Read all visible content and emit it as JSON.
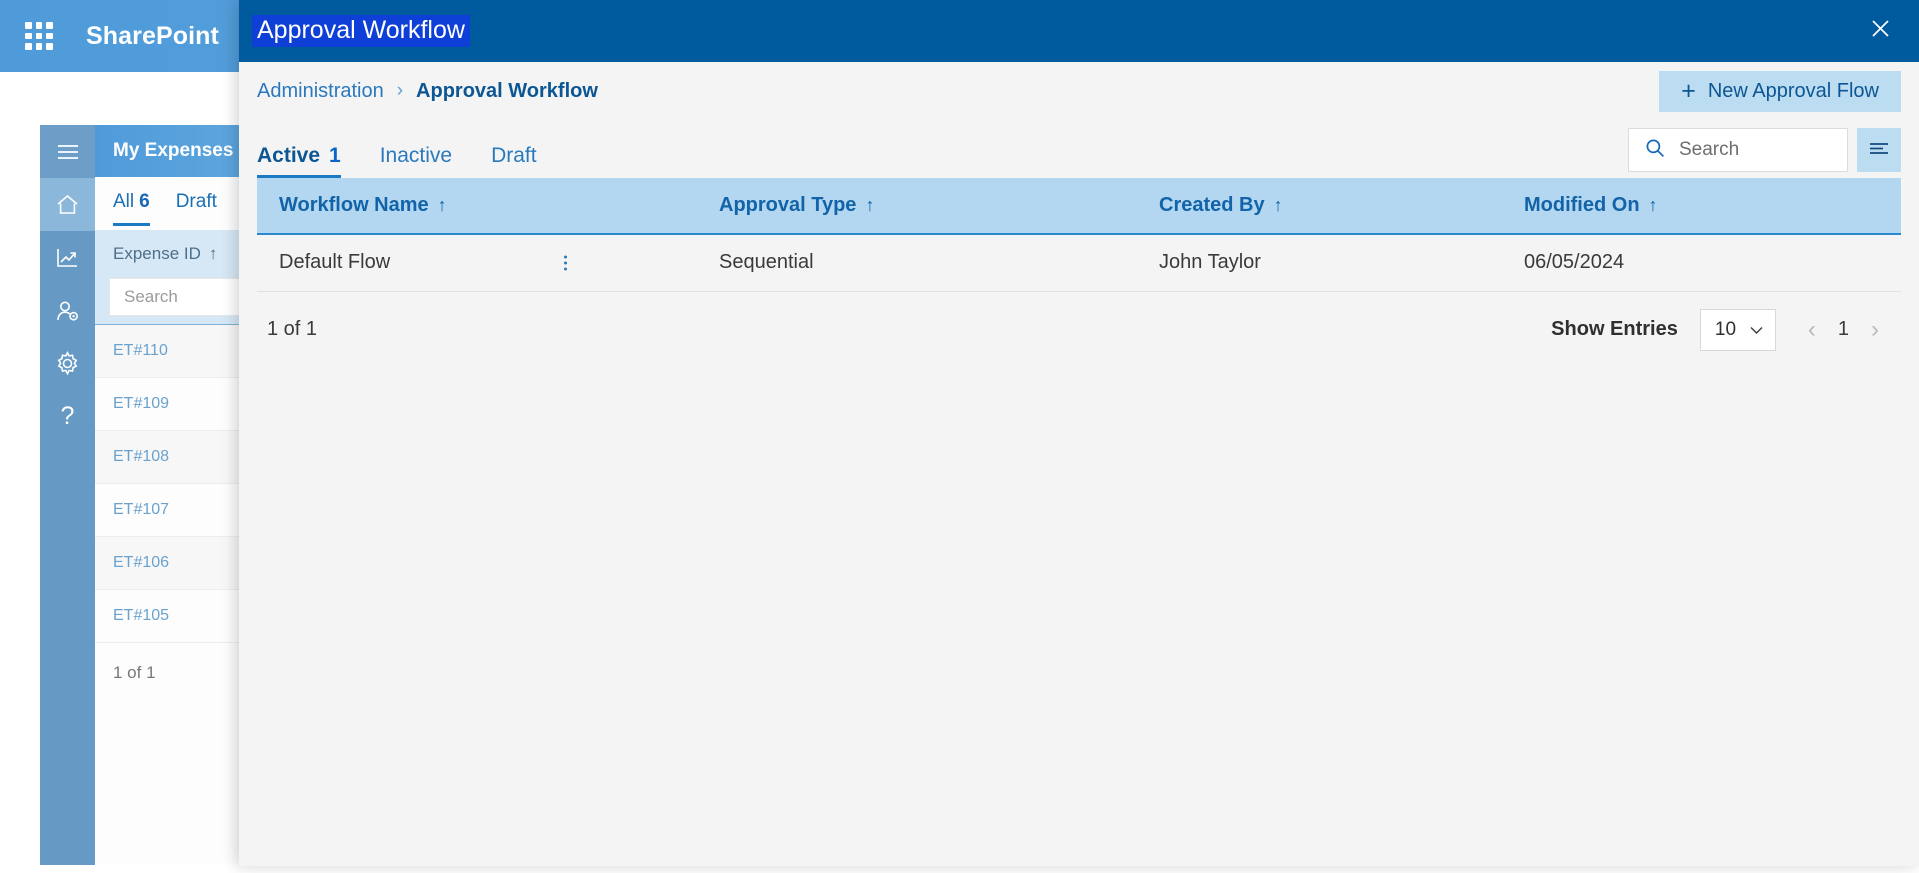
{
  "suite": {
    "waffle_icon": "app-launcher-icon",
    "brand": "SharePoint"
  },
  "background_app": {
    "rail": [
      {
        "name": "hamburger-menu",
        "icon": "hamburger-icon"
      },
      {
        "name": "home",
        "icon": "home-icon",
        "active": true
      },
      {
        "name": "analytics",
        "icon": "chart-line-icon"
      },
      {
        "name": "user-settings",
        "icon": "user-gear-icon"
      },
      {
        "name": "settings",
        "icon": "gear-icon"
      },
      {
        "name": "help",
        "icon": "question-mark-icon"
      }
    ],
    "panel": {
      "title": "My Expenses",
      "tabs": [
        {
          "label": "All",
          "count": "6",
          "selected": true
        },
        {
          "label": "Draft",
          "count": "",
          "selected": false
        }
      ],
      "column_header": "Expense ID",
      "column_sort": "↑",
      "search_placeholder": "Search",
      "rows": [
        "ET#110",
        "ET#109",
        "ET#108",
        "ET#107",
        "ET#106",
        "ET#105"
      ],
      "footer": "1 of 1"
    }
  },
  "modal": {
    "title": "Approval Workflow",
    "close_icon": "close-icon",
    "breadcrumb": {
      "parent": "Administration",
      "separator": "›",
      "current": "Approval Workflow"
    },
    "new_button": {
      "plus": "+",
      "label": "New Approval Flow"
    },
    "tabs": [
      {
        "label": "Active",
        "badge": "1",
        "selected": true
      },
      {
        "label": "Inactive",
        "badge": "",
        "selected": false
      },
      {
        "label": "Draft",
        "badge": "",
        "selected": false
      }
    ],
    "search": {
      "placeholder": "Search",
      "icon": "search-icon"
    },
    "filter_icon": "filter-lines-icon",
    "table": {
      "columns": [
        {
          "label": "Workflow Name",
          "sort": "↑"
        },
        {
          "label": "Approval Type",
          "sort": "↑"
        },
        {
          "label": "Created By",
          "sort": "↑"
        },
        {
          "label": "Modified On",
          "sort": "↑"
        }
      ],
      "rows": [
        {
          "workflow_name": "Default Flow",
          "approval_type": "Sequential",
          "created_by": "John Taylor",
          "modified_on": "06/05/2024",
          "row_menu_icon": "kebab-menu-icon"
        }
      ]
    },
    "footer": {
      "count": "1 of 1",
      "show_entries_label": "Show Entries",
      "entries_value": "10",
      "entries_chevron": "chevron-down-icon",
      "prev": "‹",
      "page": "1",
      "next": "›"
    }
  },
  "colors": {
    "suite_blue": "#5aa3dd",
    "modal_header": "#005a9e",
    "title_highlight": "#0e3fd6",
    "accent": "#1a7ac4",
    "table_header": "#b3d7f0",
    "button_fill": "#bcdcf2",
    "rail": "#6699c4",
    "body": "#f4f4f4"
  }
}
